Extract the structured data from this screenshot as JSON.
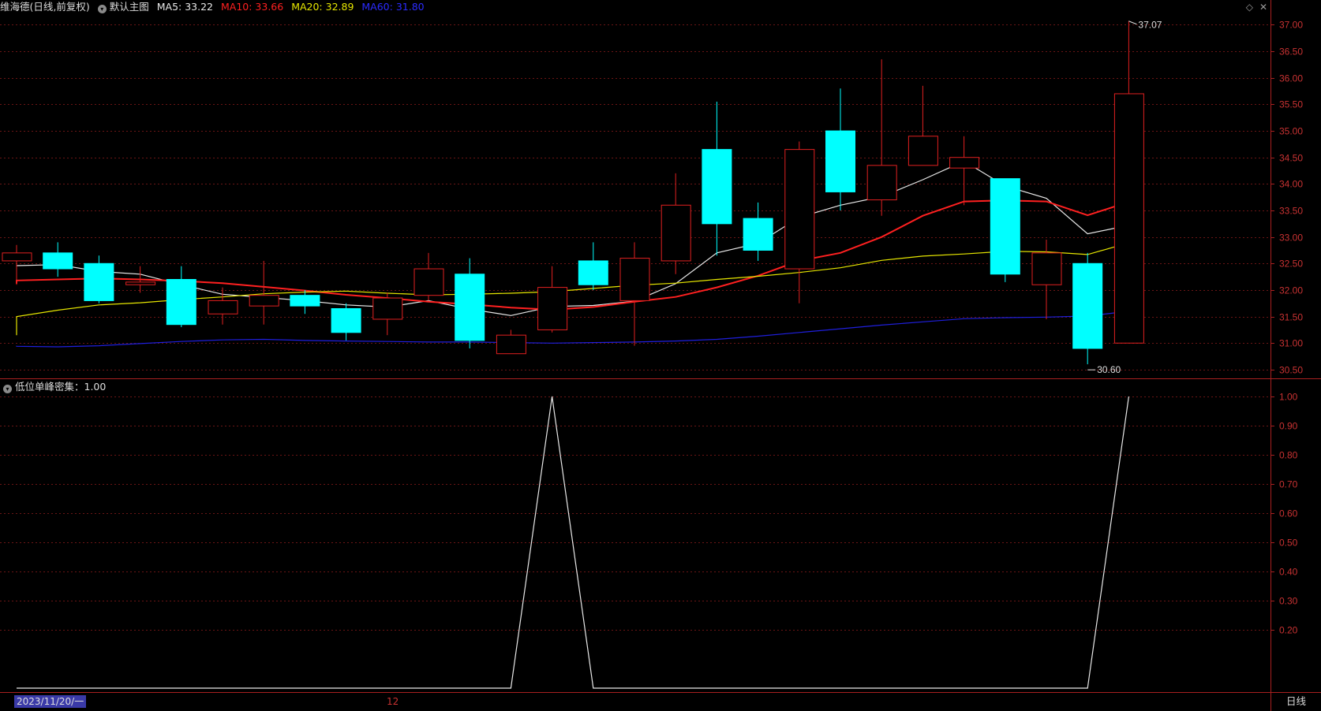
{
  "header": {
    "stock_name": "维海德(日线,前复权)",
    "template_label": "默认主图",
    "ma5_label": "MA5: 33.22",
    "ma10_label": "MA10: 33.66",
    "ma20_label": "MA20: 32.89",
    "ma60_label": "MA60: 31.80",
    "icon_names": [
      "diamond-icon",
      "close-icon"
    ]
  },
  "colors": {
    "up": "#e02020",
    "down": "#00ffff",
    "ma5": "#e8e8e8",
    "ma10": "#ff2020",
    "ma20": "#e6e600",
    "ma60": "#1f1fdd",
    "grid": "#6b1515",
    "axis_text": "#c83232",
    "indicator_line": "#e8e8e8"
  },
  "chart_data": [
    {
      "type": "candlestick",
      "title": "维海德(日线,前复权)",
      "ylim": [
        30.35,
        37.2
      ],
      "y_ticks": [
        "30.50",
        "31.00",
        "31.50",
        "32.00",
        "32.50",
        "33.00",
        "33.50",
        "34.00",
        "34.50",
        "35.00",
        "35.50",
        "36.00",
        "36.50",
        "37.00"
      ],
      "grid": true,
      "candles": [
        {
          "o": 32.55,
          "h": 32.85,
          "l": 32.1,
          "c": 32.7
        },
        {
          "o": 32.7,
          "h": 32.9,
          "l": 32.25,
          "c": 32.4
        },
        {
          "o": 32.5,
          "h": 32.65,
          "l": 31.75,
          "c": 31.8
        },
        {
          "o": 32.1,
          "h": 32.45,
          "l": 31.95,
          "c": 32.15
        },
        {
          "o": 32.2,
          "h": 32.45,
          "l": 31.3,
          "c": 31.35
        },
        {
          "o": 31.55,
          "h": 32.05,
          "l": 31.35,
          "c": 31.8
        },
        {
          "o": 31.7,
          "h": 32.55,
          "l": 31.35,
          "c": 31.9
        },
        {
          "o": 31.9,
          "h": 32.0,
          "l": 31.55,
          "c": 31.7
        },
        {
          "o": 31.65,
          "h": 31.75,
          "l": 31.05,
          "c": 31.2
        },
        {
          "o": 31.45,
          "h": 31.95,
          "l": 31.15,
          "c": 31.85
        },
        {
          "o": 31.9,
          "h": 32.7,
          "l": 31.8,
          "c": 32.4
        },
        {
          "o": 32.3,
          "h": 32.6,
          "l": 30.9,
          "c": 31.05
        },
        {
          "o": 30.8,
          "h": 31.25,
          "l": 30.8,
          "c": 31.15
        },
        {
          "o": 31.25,
          "h": 32.45,
          "l": 31.2,
          "c": 32.05
        },
        {
          "o": 32.55,
          "h": 32.9,
          "l": 32.0,
          "c": 32.1
        },
        {
          "o": 31.8,
          "h": 32.9,
          "l": 30.95,
          "c": 32.6
        },
        {
          "o": 32.55,
          "h": 34.2,
          "l": 32.3,
          "c": 33.6
        },
        {
          "o": 34.65,
          "h": 35.55,
          "l": 32.65,
          "c": 33.25
        },
        {
          "o": 33.35,
          "h": 33.65,
          "l": 32.55,
          "c": 32.75
        },
        {
          "o": 32.4,
          "h": 34.8,
          "l": 31.75,
          "c": 34.65
        },
        {
          "o": 35.0,
          "h": 35.8,
          "l": 33.5,
          "c": 33.85
        },
        {
          "o": 33.7,
          "h": 36.35,
          "l": 33.4,
          "c": 34.35
        },
        {
          "o": 34.35,
          "h": 35.85,
          "l": 34.35,
          "c": 34.9
        },
        {
          "o": 34.3,
          "h": 34.9,
          "l": 33.6,
          "c": 34.5
        },
        {
          "o": 34.1,
          "h": 34.1,
          "l": 32.15,
          "c": 32.3
        },
        {
          "o": 32.1,
          "h": 32.95,
          "l": 31.45,
          "c": 32.7
        },
        {
          "o": 32.5,
          "h": 32.7,
          "l": 30.6,
          "c": 30.9
        },
        {
          "o": 31.0,
          "h": 37.07,
          "l": 31.0,
          "c": 35.7
        }
      ],
      "series": [
        {
          "name": "MA5",
          "values": [
            32.46,
            32.48,
            32.35,
            32.3,
            32.1,
            31.92,
            31.86,
            31.8,
            31.72,
            31.68,
            31.8,
            31.64,
            31.52,
            31.69,
            31.71,
            31.79,
            32.12,
            32.7,
            32.88,
            33.37,
            33.6,
            33.76,
            34.08,
            34.43,
            33.96,
            33.73,
            33.06,
            33.22
          ]
        },
        {
          "name": "MA10",
          "values": [
            32.12,
            32.15,
            32.18,
            32.2,
            32.22,
            32.2,
            32.17,
            32.13,
            32.06,
            31.99,
            31.91,
            31.85,
            31.78,
            31.73,
            31.67,
            31.63,
            31.68,
            31.78,
            31.87,
            32.05,
            32.27,
            32.55,
            32.7,
            33.0,
            33.4,
            33.67,
            33.69,
            33.67,
            33.41,
            33.66
          ]
        },
        {
          "name": "MA20",
          "values": [
            31.15,
            31.38,
            31.5,
            31.62,
            31.72,
            31.76,
            31.82,
            31.87,
            31.93,
            31.96,
            31.98,
            31.94,
            31.91,
            31.92,
            31.94,
            31.97,
            32.03,
            32.09,
            32.13,
            32.2,
            32.26,
            32.33,
            32.42,
            32.56,
            32.64,
            32.68,
            32.73,
            32.72,
            32.67,
            32.89
          ]
        },
        {
          "name": "MA60",
          "values": [
            30.95,
            30.95,
            30.94,
            30.93,
            30.95,
            30.99,
            31.03,
            31.06,
            31.07,
            31.05,
            31.04,
            31.03,
            31.02,
            31.02,
            31.01,
            31.0,
            31.01,
            31.02,
            31.04,
            31.07,
            31.13,
            31.2,
            31.27,
            31.34,
            31.4,
            31.46,
            31.48,
            31.49,
            31.51,
            31.6
          ]
        }
      ],
      "annotations": [
        "37.07",
        "30.60"
      ]
    },
    {
      "type": "line",
      "title": "低位单峰密集：1.00",
      "ylim": [
        0,
        1.0
      ],
      "y_ticks": [
        "0.20",
        "0.30",
        "0.40",
        "0.50",
        "0.60",
        "0.70",
        "0.80",
        "0.90",
        "1.00"
      ],
      "grid": true,
      "series": [
        {
          "name": "低位单峰密集",
          "values": [
            0,
            0,
            0,
            0,
            0,
            0,
            0,
            0,
            0,
            0,
            0,
            0,
            0,
            1,
            0,
            0,
            0,
            0,
            0,
            0,
            0,
            0,
            0,
            0,
            0,
            0,
            0,
            1
          ]
        }
      ]
    }
  ],
  "footer": {
    "date_label": "2023/11/20/一",
    "month_label": "12",
    "period_label": "日线"
  }
}
